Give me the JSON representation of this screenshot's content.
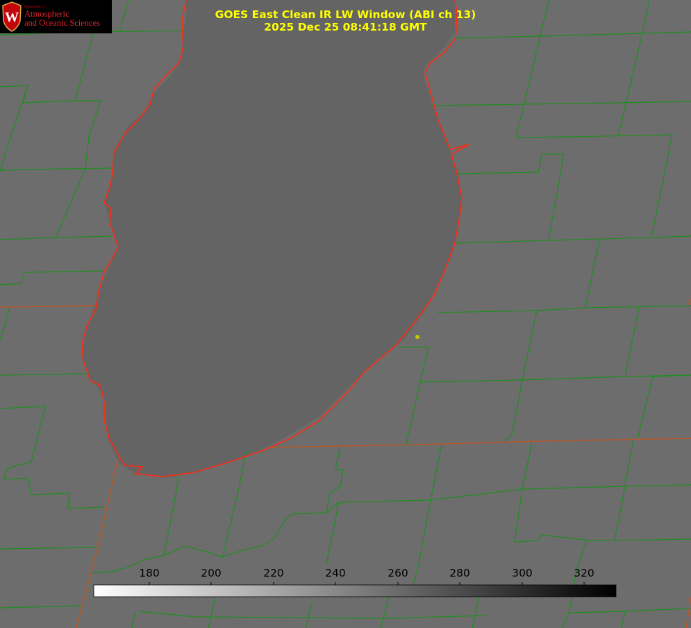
{
  "logo": {
    "dept": "Department of",
    "line1": "Atmospheric",
    "line2": "and Oceanic Sciences",
    "seal_letter": "W"
  },
  "title": {
    "line1": "GOES East Clean IR LW Window (ABI ch 13)",
    "line2": "2025 Dec 25 08:41:18 GMT"
  },
  "colorbar": {
    "ticks": [
      "180",
      "200",
      "220",
      "240",
      "260",
      "280",
      "300",
      "320"
    ],
    "min": 162,
    "max": 330,
    "gradient": [
      "#ffffff",
      "#000000"
    ]
  },
  "colors": {
    "background": "#6d6d6d",
    "lake": "#646464",
    "county_lines": "#1e8f1e",
    "coastline": "#ff2a10",
    "state_line": "#c8501a",
    "marker": "#c8c800",
    "title": "#ffff00"
  },
  "map_features": [
    "lake-michigan",
    "county-boundaries",
    "state-boundaries",
    "city-marker"
  ]
}
